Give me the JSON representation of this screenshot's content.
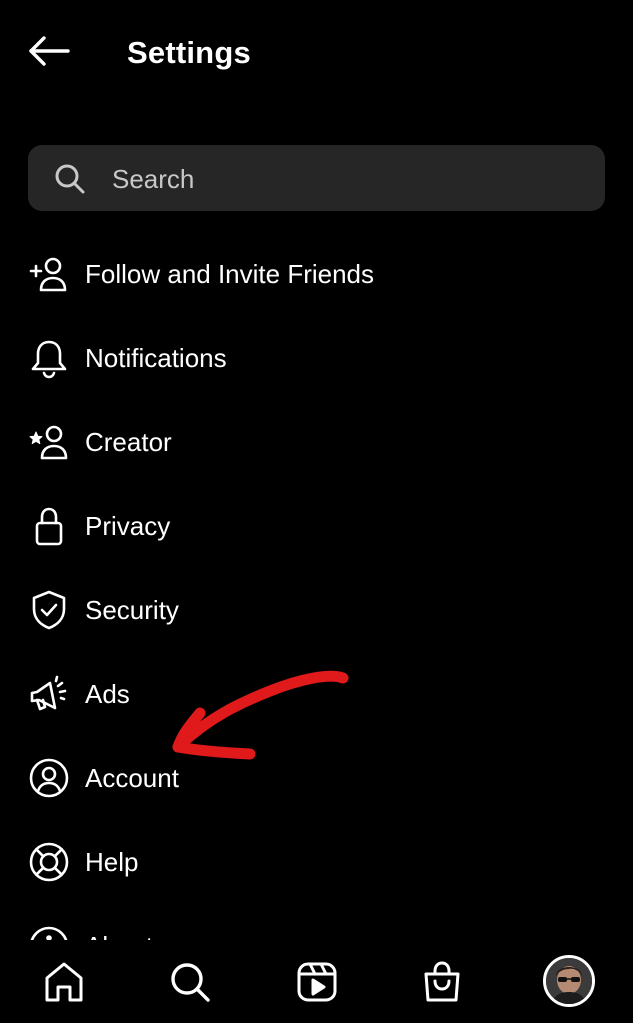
{
  "header": {
    "title": "Settings",
    "back_icon": "arrow-left-icon"
  },
  "search": {
    "placeholder": "Search",
    "value": "",
    "icon": "search-icon"
  },
  "menu": {
    "items": [
      {
        "label": "Follow and Invite Friends",
        "icon": "add-person-icon"
      },
      {
        "label": "Notifications",
        "icon": "bell-icon"
      },
      {
        "label": "Creator",
        "icon": "star-person-icon"
      },
      {
        "label": "Privacy",
        "icon": "lock-icon"
      },
      {
        "label": "Security",
        "icon": "shield-check-icon"
      },
      {
        "label": "Ads",
        "icon": "megaphone-icon"
      },
      {
        "label": "Account",
        "icon": "account-circle-icon"
      },
      {
        "label": "Help",
        "icon": "lifebuoy-icon"
      },
      {
        "label": "About",
        "icon": "info-icon"
      }
    ]
  },
  "annotation": {
    "color": "#e0191b",
    "points_to": "Account"
  },
  "bottom_nav": {
    "items": [
      {
        "icon": "home-icon"
      },
      {
        "icon": "search-icon"
      },
      {
        "icon": "reels-icon"
      },
      {
        "icon": "shop-bag-icon"
      },
      {
        "icon": "profile-avatar"
      }
    ]
  },
  "colors": {
    "background": "#000000",
    "search_field": "#262626",
    "text": "#ffffff",
    "placeholder": "#c8c8c8"
  }
}
